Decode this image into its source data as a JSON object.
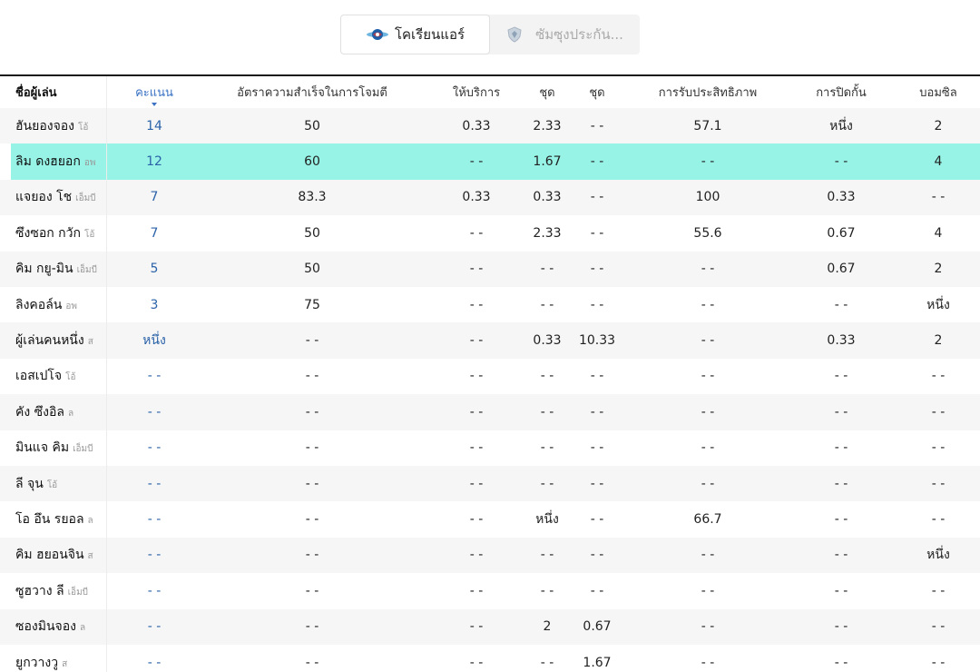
{
  "team_tabs": [
    {
      "label": "โคเรียนแอร์",
      "active": true,
      "logo": "korean-air-logo-icon"
    },
    {
      "label": "ซัมซุงประกัน...",
      "active": false,
      "logo": "samsung-shield-logo-icon"
    }
  ],
  "columns": {
    "name": "ชื่อผู้เล่น",
    "score": "คะแนน",
    "attack": "อัตราความสำเร็จในการโจมตี",
    "serve": "ให้บริการ",
    "set1": "ชุด",
    "set2": "ชุด",
    "receive": "การรับประสิทธิภาพ",
    "block": "การปิดกั้น",
    "dig": "บอมซิล"
  },
  "players": [
    {
      "name": "ฮันยองจอง",
      "pos": "โอ้",
      "score": "14",
      "attack": "50",
      "serve": "0.33",
      "set1": "2.33",
      "set2": "- -",
      "receive": "57.1",
      "block": "หนึ่ง",
      "dig": "2"
    },
    {
      "name": "ลิม ดงฮยอก",
      "pos": "อพ",
      "score": "12",
      "attack": "60",
      "serve": "- -",
      "set1": "1.67",
      "set2": "- -",
      "receive": "- -",
      "block": "- -",
      "dig": "4",
      "highlight": true
    },
    {
      "name": "แจยอง โช",
      "pos": "เอ็มบี",
      "score": "7",
      "attack": "83.3",
      "serve": "0.33",
      "set1": "0.33",
      "set2": "- -",
      "receive": "100",
      "block": "0.33",
      "dig": "- -"
    },
    {
      "name": "ซึงซอก กวัก",
      "pos": "โอ้",
      "score": "7",
      "attack": "50",
      "serve": "- -",
      "set1": "2.33",
      "set2": "- -",
      "receive": "55.6",
      "block": "0.67",
      "dig": "4"
    },
    {
      "name": "คิม กยู-มิน",
      "pos": "เอ็มบี",
      "score": "5",
      "attack": "50",
      "serve": "- -",
      "set1": "- -",
      "set2": "- -",
      "receive": "- -",
      "block": "0.67",
      "dig": "2"
    },
    {
      "name": "ลิงคอล์น",
      "pos": "อพ",
      "score": "3",
      "attack": "75",
      "serve": "- -",
      "set1": "- -",
      "set2": "- -",
      "receive": "- -",
      "block": "- -",
      "dig": "หนึ่ง"
    },
    {
      "name": "ผู้เล่นคนหนึ่ง",
      "pos": "ส",
      "score": "หนึ่ง",
      "attack": "- -",
      "serve": "- -",
      "set1": "0.33",
      "set2": "10.33",
      "receive": "- -",
      "block": "0.33",
      "dig": "2"
    },
    {
      "name": "เอสเปโจ",
      "pos": "โอ้",
      "score": "- -",
      "attack": "- -",
      "serve": "- -",
      "set1": "- -",
      "set2": "- -",
      "receive": "- -",
      "block": "- -",
      "dig": "- -"
    },
    {
      "name": "คัง ซึงอิล",
      "pos": "ล",
      "score": "- -",
      "attack": "- -",
      "serve": "- -",
      "set1": "- -",
      "set2": "- -",
      "receive": "- -",
      "block": "- -",
      "dig": "- -"
    },
    {
      "name": "มินแจ คิม",
      "pos": "เอ็มบี",
      "score": "- -",
      "attack": "- -",
      "serve": "- -",
      "set1": "- -",
      "set2": "- -",
      "receive": "- -",
      "block": "- -",
      "dig": "- -"
    },
    {
      "name": "ลี จุน",
      "pos": "โอ้",
      "score": "- -",
      "attack": "- -",
      "serve": "- -",
      "set1": "- -",
      "set2": "- -",
      "receive": "- -",
      "block": "- -",
      "dig": "- -"
    },
    {
      "name": "โอ อึน รยอล",
      "pos": "ล",
      "score": "- -",
      "attack": "- -",
      "serve": "- -",
      "set1": "หนึ่ง",
      "set2": "- -",
      "receive": "66.7",
      "block": "- -",
      "dig": "- -"
    },
    {
      "name": "คิม ฮยอนจิน",
      "pos": "ส",
      "score": "- -",
      "attack": "- -",
      "serve": "- -",
      "set1": "- -",
      "set2": "- -",
      "receive": "- -",
      "block": "- -",
      "dig": "หนึ่ง"
    },
    {
      "name": "ซูฮวาง ลี",
      "pos": "เอ็มบี",
      "score": "- -",
      "attack": "- -",
      "serve": "- -",
      "set1": "- -",
      "set2": "- -",
      "receive": "- -",
      "block": "- -",
      "dig": "- -"
    },
    {
      "name": "ซองมินจอง",
      "pos": "ล",
      "score": "- -",
      "attack": "- -",
      "serve": "- -",
      "set1": "2",
      "set2": "0.67",
      "receive": "- -",
      "block": "- -",
      "dig": "- -"
    },
    {
      "name": "ยูกวางวู",
      "pos": "ส",
      "score": "- -",
      "attack": "- -",
      "serve": "- -",
      "set1": "- -",
      "set2": "1.67",
      "receive": "- -",
      "block": "- -",
      "dig": "- -"
    }
  ],
  "colors": {
    "highlight_row": "#96f3e6",
    "score_text": "#2b63a8",
    "alt_row": "#f6f6f6"
  }
}
